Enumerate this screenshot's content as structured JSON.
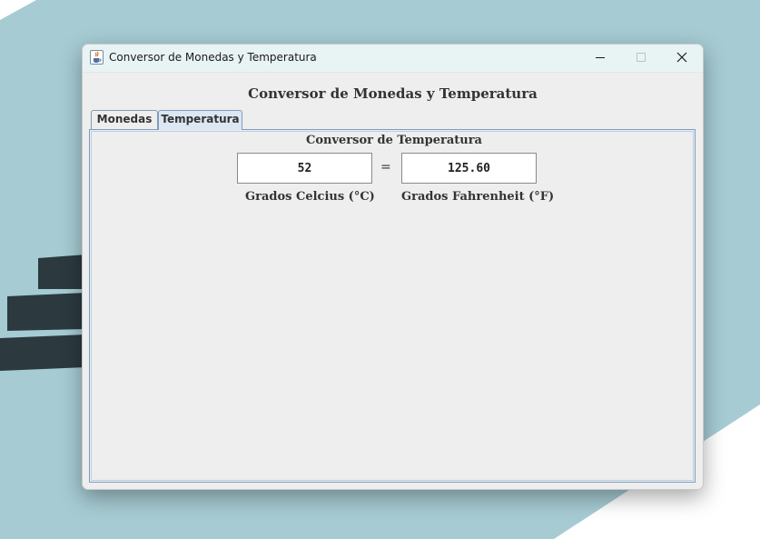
{
  "window": {
    "title": "Conversor de Monedas y Temperatura"
  },
  "main": {
    "title": "Conversor de Monedas y Temperatura",
    "tabs": [
      {
        "label": "Monedas",
        "selected": false
      },
      {
        "label": "Temperatura",
        "selected": true
      }
    ]
  },
  "temperature": {
    "section_title": "Conversor de Temperatura",
    "celsius_value": "52",
    "equals_sign": "=",
    "fahrenheit_value": "125.60",
    "celsius_label": "Grados Celcius (°C)",
    "fahrenheit_label": "Grados Fahrenheit (°F)"
  },
  "icons": {
    "app": "java-cup-icon",
    "minimize": "minimize-icon",
    "maximize": "maximize-icon",
    "close": "close-icon"
  },
  "colors": {
    "titlebar": "#e8f3f4",
    "window_bg": "#eeeeee",
    "selected_tab": "#dce7f3",
    "tab_border": "#7f9db9",
    "desktop_teal": "#a6cbd3",
    "desktop_dark": "#2c3a3f"
  }
}
